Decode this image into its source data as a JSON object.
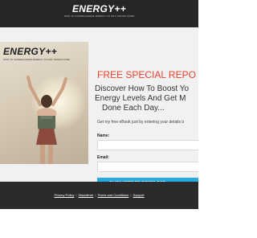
{
  "header": {
    "logo_title": "ENERGY++",
    "logo_tagline": "HOW TO SUPERCHARGE ENERGY TO GET THINGS DONE"
  },
  "cover": {
    "title": "ENERGY++",
    "tagline": "HOW TO SUPERCHARGE ENERGY TO GET THINGS DONE"
  },
  "offer": {
    "headline": "FREE SPECIAL REPO",
    "subhead_line1": "Discover How To Boost Yo",
    "subhead_line2": "Energy Levels And Get M",
    "subhead_line3": "Done Each Day...",
    "intro": "Get my free eBook just by entering your details b",
    "name_label": "Name:",
    "name_value": "",
    "email_label": "Email:",
    "email_value": "",
    "button_label": "CLICK HERE TO DOWNLOAD"
  },
  "footer": {
    "links": [
      "Privacy Policy",
      "Disclaimer",
      "Terms and Conditions",
      "Support"
    ],
    "separator": "|"
  },
  "colors": {
    "header_bg": "#262626",
    "main_bg": "#f1f1f1",
    "headline": "#e8432e",
    "button": "#27a9e1",
    "footer_bg": "#2b2b2b"
  }
}
